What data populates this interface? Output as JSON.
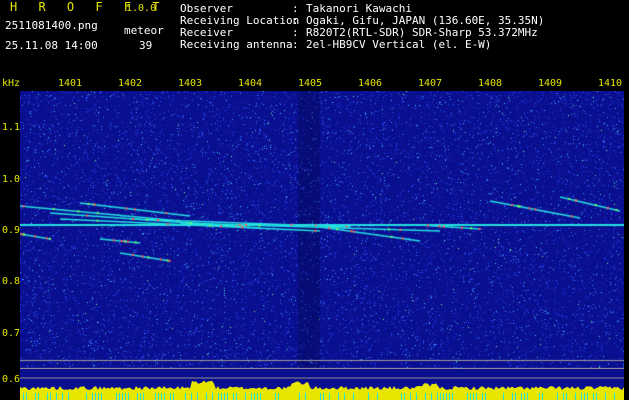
{
  "header": {
    "brand": "H R O F F T",
    "version": "1.0.0",
    "filename": "2511081400.png",
    "meteor_label": "meteor",
    "timestamp": "25.11.08 14:00",
    "meteor_count": "39",
    "info": [
      {
        "label": "Observer",
        "value": "Takanori Kawachi"
      },
      {
        "label": "Receiving Location",
        "value": "Ogaki, Gifu, JAPAN (136.60E, 35.35N)"
      },
      {
        "label": "Receiver",
        "value": "R820T2(RTL-SDR) SDR-Sharp 53.372MHz"
      },
      {
        "label": "Receiving antenna",
        "value": "2el-HB9CV Vertical (el. E-W)"
      }
    ]
  },
  "axis": {
    "unit": "kHz",
    "top_ticks": [
      "1401",
      "1402",
      "1403",
      "1404",
      "1405",
      "1406",
      "1407",
      "1408",
      "1409",
      "1410"
    ],
    "left_ticks": [
      "1.1",
      "1.0",
      "0.9",
      "0.8",
      "0.7",
      "0.6"
    ]
  },
  "colors": {
    "text_accent": "#e6e600",
    "background_noise": "#0a0f90",
    "echo_line": "#22e0e0",
    "echo_hot": "#ff5050"
  }
}
